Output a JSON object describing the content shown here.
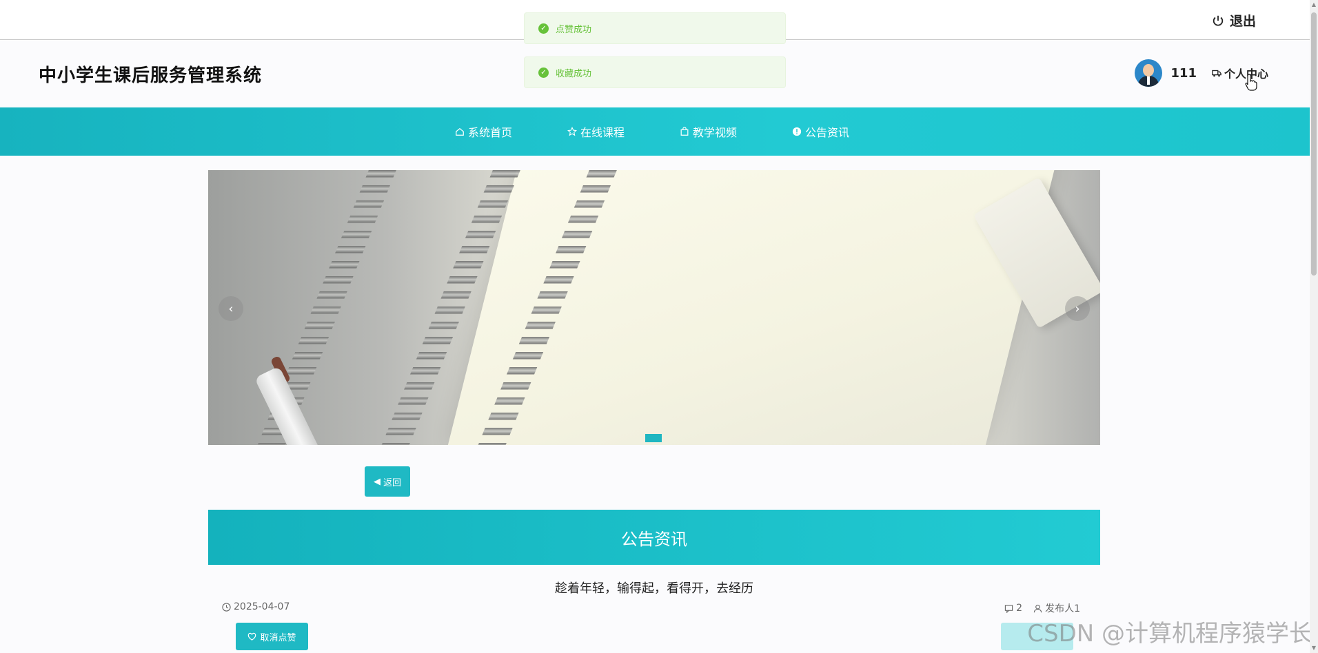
{
  "topbar": {
    "logout_label": "退出"
  },
  "header": {
    "site_title": "中小学生课后服务管理系统",
    "username": "111",
    "personal_center": "个人中心"
  },
  "toasts": [
    {
      "message": "点赞成功"
    },
    {
      "message": "收藏成功"
    }
  ],
  "nav": {
    "items": [
      {
        "label": "系统首页",
        "icon": "home-icon"
      },
      {
        "label": "在线课程",
        "icon": "star-icon"
      },
      {
        "label": "教学视频",
        "icon": "bag-icon"
      },
      {
        "label": "公告资讯",
        "icon": "info-icon"
      }
    ]
  },
  "carousel": {
    "prev": "‹",
    "next": "›",
    "active_index": 0
  },
  "back_label": "返回",
  "section": {
    "title": "公告资讯"
  },
  "article": {
    "title": "趁着年轻，输得起，看得开，去经历",
    "date": "2025-04-07",
    "comments": "2",
    "publisher": "发布人1"
  },
  "actions": {
    "unlike_label": "取消点赞"
  },
  "watermark": "CSDN @计算机程序猿学长",
  "colors": {
    "accent": "#1fb9c4",
    "success": "#67c23a"
  }
}
